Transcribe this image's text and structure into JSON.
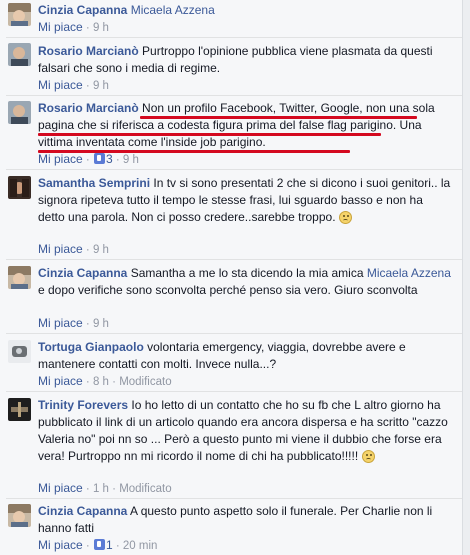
{
  "comments": [
    {
      "author": "Cinzia Capanna",
      "text": "",
      "mention": "Micaela Azzena",
      "mention_suffix": "",
      "like_label": "Mi piace",
      "sep": "·",
      "time": "9 h",
      "likes": "",
      "modified": ""
    },
    {
      "author": "Rosario Marcianò",
      "text": "Purtroppo l'opinione pubblica viene plasmata da questi falsari che sono i media di regime.",
      "like_label": "Mi piace",
      "sep": "·",
      "time": "9 h",
      "likes": "",
      "modified": ""
    },
    {
      "author": "Rosario Marcianò",
      "text": "Non un profilo Facebook, Twitter, Google, non una sola pagina che si riferisca a codesta figura prima del false flag parigino. Una vittima inventata come l'inside job parigino.",
      "like_label": "Mi piace",
      "sep": "·",
      "time": "9 h",
      "likes": "3",
      "modified": ""
    },
    {
      "author": "Samantha Semprini",
      "text": "In tv si sono presentati 2 che si dicono i suoi genitori.. la signora ripeteva tutto il tempo le stesse frasi, lui sguardo basso e non ha detto una parola. Non ci posso credere..sarebbe troppo.",
      "like_label": "Mi piace",
      "sep": "·",
      "time": "9 h",
      "likes": "",
      "modified": ""
    },
    {
      "author": "Cinzia Capanna",
      "text": "Samantha a me lo sta dicendo la mia amica",
      "mention": "Micaela Azzena",
      "mention_suffix": "e dopo verifiche sono sconvolta perché penso sia vero. Giuro sconvolta",
      "like_label": "Mi piace",
      "sep": "·",
      "time": "9 h",
      "likes": "",
      "modified": ""
    },
    {
      "author": "Tortuga Gianpaolo",
      "text": "volontaria emergency, viaggia, dovrebbe avere e mantenere contatti con molti. Invece nulla...?",
      "like_label": "Mi piace",
      "sep": "·",
      "time": "8 h",
      "likes": "",
      "modified": "Modificato"
    },
    {
      "author": "Trinity Forevers",
      "text": "Io ho letto di un contatto che ho su fb che L altro giorno ha pubblicato il link di un articolo quando era ancora dispersa e ha scritto \"cazzo Valeria no\" poi nn so ... Però a questo punto mi viene il dubbio che forse era vera! Purtroppo nn mi ricordo il nome di chi ha pubblicato!!!!!",
      "like_label": "Mi piace",
      "sep": "·",
      "time": "1 h",
      "likes": "",
      "modified": "Modificato"
    },
    {
      "author": "Cinzia Capanna",
      "text": "A questo punto aspetto solo il funerale. Per Charlie non li hanno fatti",
      "like_label": "Mi piace",
      "sep": "·",
      "time": "20 min",
      "likes": "1",
      "modified": ""
    }
  ],
  "colors": {
    "link": "#3b5998",
    "meta": "#9197a3",
    "underline": "#d4091f"
  },
  "icons": {
    "like": "thumbs-up-icon",
    "emoticon": "sad-face-icon"
  }
}
